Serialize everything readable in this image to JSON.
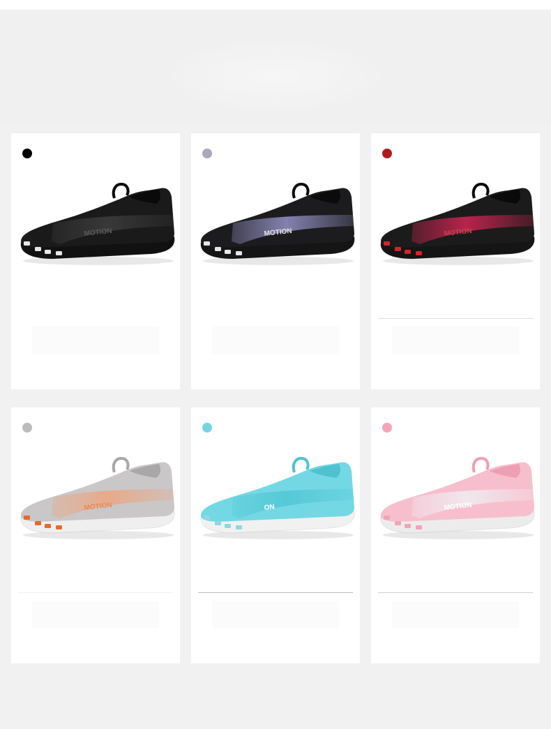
{
  "products": [
    {
      "color_name": "black",
      "dot_color": "#000000",
      "upper_color": "#1a1a1a",
      "upper_dark": "#0a0a0a",
      "band_color": "#3a3a3a",
      "sole_color": "#111111",
      "toe_accent": "#e6e6e6",
      "logo_text": "MOTION",
      "logo_color": "#5a5a5a",
      "reflection_line": "#ffffff"
    },
    {
      "color_name": "gray-purple",
      "dot_color": "#a9a9b8",
      "upper_color": "#1c1c1e",
      "upper_dark": "#0b0b0c",
      "band_color": "#8a86b6",
      "sole_color": "#151515",
      "toe_accent": "#e6e6e6",
      "logo_text": "MOTION",
      "logo_color": "#e6e6e6",
      "reflection_line": "#ffffff"
    },
    {
      "color_name": "red",
      "dot_color": "#b01a1f",
      "upper_color": "#1b1b1b",
      "upper_dark": "#0a0a0a",
      "band_color": "#c0244e",
      "sole_color": "#151515",
      "toe_accent": "#d8232a",
      "logo_text": "MOTION",
      "logo_color": "#c4434f",
      "reflection_line": "#dddddd"
    },
    {
      "color_name": "light-gray",
      "dot_color": "#bcbcbc",
      "upper_color": "#c9c7c8",
      "upper_dark": "#a9a7a8",
      "band_color": "#e9a887",
      "sole_color": "#efefef",
      "toe_accent": "#e66a2a",
      "logo_text": "MOTION",
      "logo_color": "#e98b55",
      "reflection_line": "#f2f2f2"
    },
    {
      "color_name": "aqua",
      "dot_color": "#74d5e1",
      "upper_color": "#74d8e4",
      "upper_dark": "#4fc2d0",
      "band_color": "#54c8d6",
      "sole_color": "#f1f1f1",
      "toe_accent": "#8fd8e2",
      "logo_text": "ON",
      "logo_color": "#ffffff",
      "reflection_line": "#bfbfbf"
    },
    {
      "color_name": "pink",
      "dot_color": "#f4a5b7",
      "upper_color": "#f7bfcd",
      "upper_dark": "#ee9fb3",
      "band_color": "#f0e9ef",
      "sole_color": "#ececec",
      "toe_accent": "#f2a3b5",
      "logo_text": "MOTION",
      "logo_color": "#ffffff",
      "reflection_line": "#cfcfcf"
    }
  ]
}
